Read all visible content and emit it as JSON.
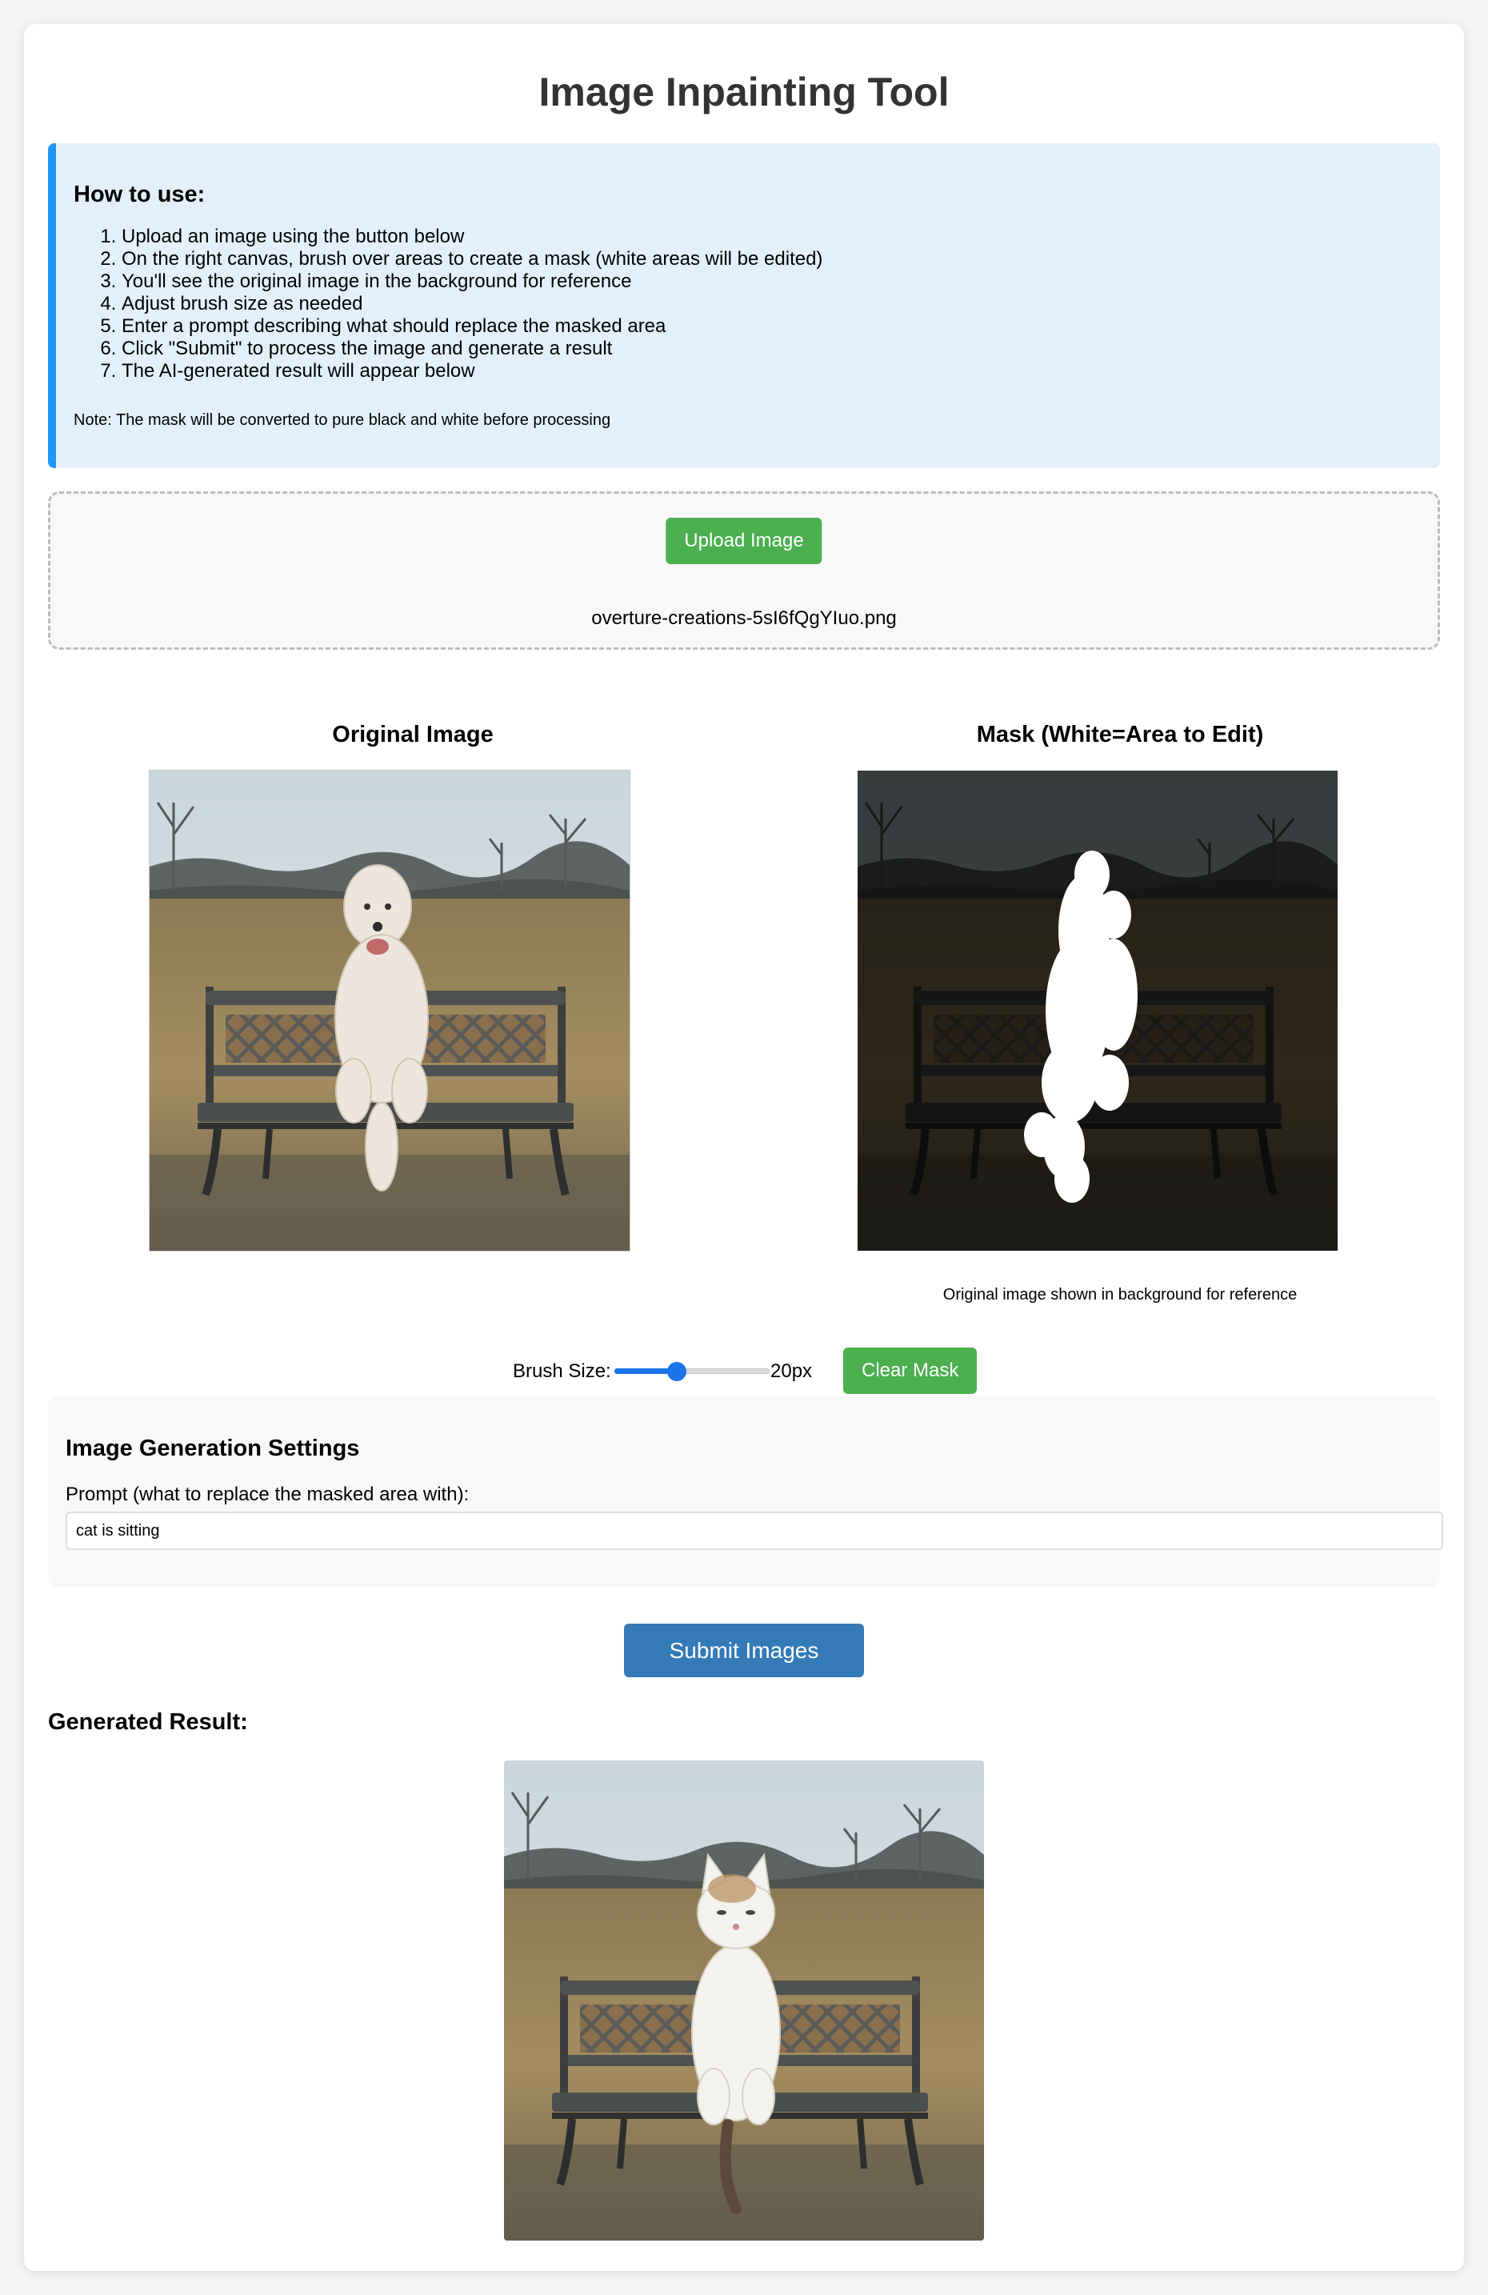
{
  "page": {
    "title": "Image Inpainting Tool"
  },
  "instructions": {
    "heading": "How to use:",
    "steps": [
      "Upload an image using the button below",
      "On the right canvas, brush over areas to create a mask (white areas will be edited)",
      "You'll see the original image in the background for reference",
      "Adjust brush size as needed",
      "Enter a prompt describing what should replace the masked area",
      "Click \"Submit\" to process the image and generate a result",
      "The AI-generated result will appear below"
    ],
    "note": "Note: The mask will be converted to pure black and white before processing"
  },
  "upload": {
    "button_label": "Upload Image",
    "filename": "overture-creations-5sI6fQgYIuo.png"
  },
  "original_panel": {
    "title": "Original Image",
    "image_icon": "dog-on-bench-photo"
  },
  "mask_panel": {
    "title": "Mask (White=Area to Edit)",
    "caption": "Original image shown in background for reference",
    "image_icon": "mask-canvas"
  },
  "brush": {
    "label": "Brush Size:",
    "value": 20,
    "value_label": "20px",
    "min": 1,
    "max": 50,
    "clear_button_label": "Clear Mask"
  },
  "settings": {
    "heading": "Image Generation Settings",
    "prompt_label": "Prompt (what to replace the masked area with):",
    "prompt_value": "cat is sitting"
  },
  "submit_label": "Submit Images",
  "result": {
    "heading": "Generated Result:",
    "image_icon": "cat-on-bench-photo"
  },
  "colors": {
    "accent_green": "#4caf50",
    "accent_blue": "#337ab7",
    "info_border": "#2196f3",
    "info_background": "#e3f0fb",
    "slider_blue": "#1a73e8"
  }
}
